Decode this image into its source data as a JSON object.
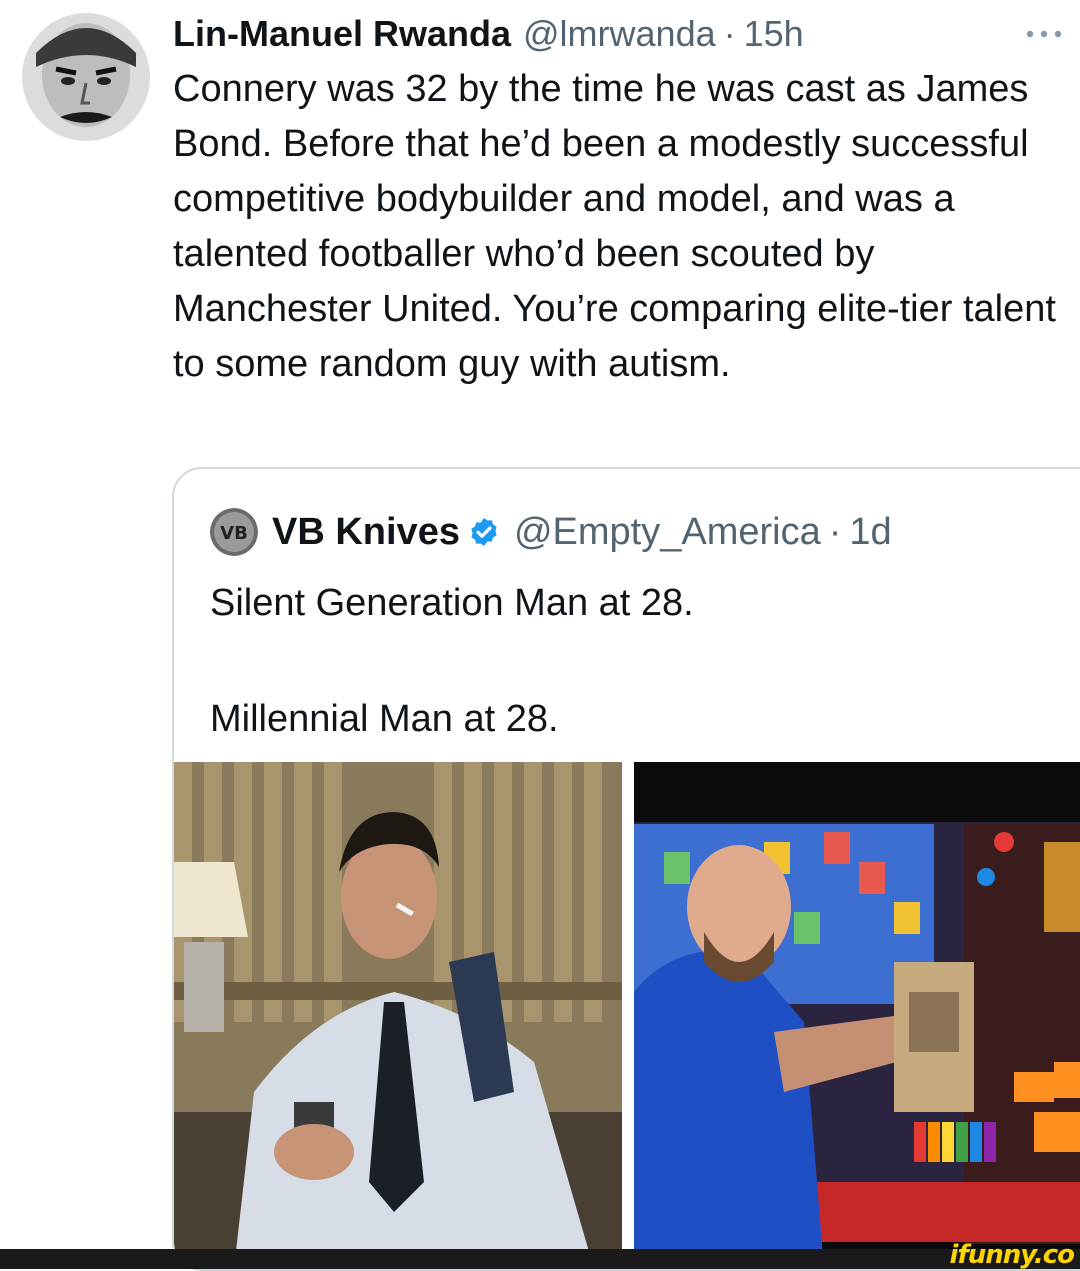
{
  "tweet": {
    "author_name": "Lin-Manuel Rwanda",
    "author_handle": "@lmrwanda",
    "separator": "·",
    "time": "15h",
    "more_icon": "more-horizontal-icon",
    "text": "Connery was 32 by the time he was cast as James Bond. Before that he’d been a modestly successful competitive bodybuilder and model, and was a talented footballer who’d been scouted by Manchester United. You’re comparing elite-tier talent to some random guy with autism."
  },
  "quote": {
    "avatar_text": "VB",
    "author_name": "VB Knives",
    "verified_icon": "verified-badge-icon",
    "author_handle": "@Empty_America",
    "separator": "·",
    "time": "1d",
    "line1": "Silent Generation Man at 28.",
    "line2": "Millennial Man at 28."
  },
  "colors": {
    "text_primary": "#0f1419",
    "text_secondary": "#536471",
    "border": "#cfd9de",
    "verified_blue": "#1d9bf0",
    "watermark": "#ffd500"
  },
  "watermark": {
    "text": "ifunny.co"
  }
}
